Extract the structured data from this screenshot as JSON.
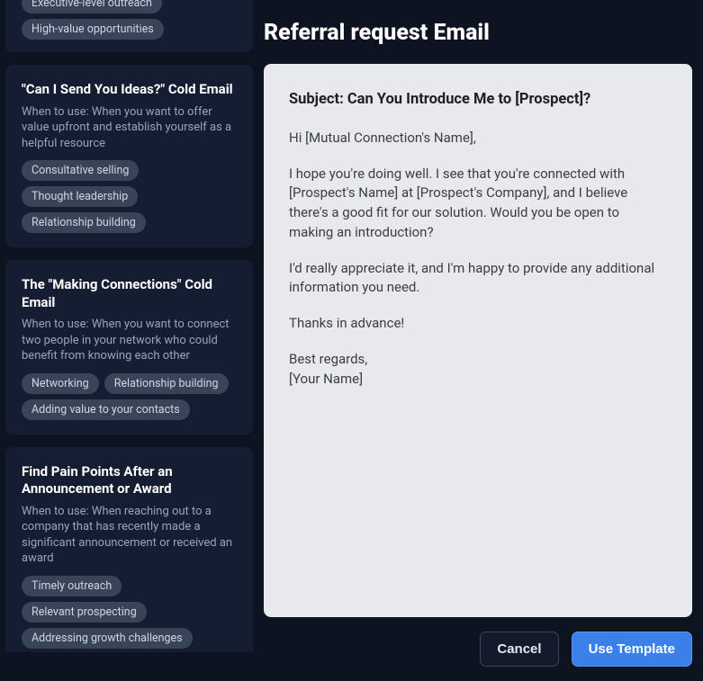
{
  "sidebar": {
    "cards": [
      {
        "title": "",
        "description": "",
        "tags": [
          "Executive-level outreach",
          "High-value opportunities"
        ]
      },
      {
        "title": "\"Can I Send You Ideas?\" Cold Email",
        "description": "When to use: When you want to offer value upfront and establish yourself as a helpful resource",
        "tags": [
          "Consultative selling",
          "Thought leadership",
          "Relationship building"
        ]
      },
      {
        "title": "The \"Making Connections\" Cold Email",
        "description": "When to use: When you want to connect two people in your network who could benefit from knowing each other",
        "tags": [
          "Networking",
          "Relationship building",
          "Adding value to your contacts"
        ]
      },
      {
        "title": "Find Pain Points After an Announcement or Award",
        "description": "When to use: When reaching out to a company that has recently made a significant announcement or received an award",
        "tags": [
          "Timely outreach",
          "Relevant prospecting",
          "Addressing growth challenges"
        ]
      }
    ]
  },
  "main": {
    "title": "Referral request Email",
    "preview": {
      "subject": "Subject: Can You Introduce Me to [Prospect]?",
      "p1": "Hi [Mutual Connection's Name],",
      "p2": "I hope you're doing well. I see that you're connected with [Prospect's Name] at [Prospect's Company], and I believe there's a good fit for our solution. Would you be open to making an introduction?",
      "p3": "I'd really appreciate it, and I'm happy to provide any additional information you need.",
      "p4": "Thanks in advance!",
      "p5": "Best regards,\n[Your Name]"
    },
    "actions": {
      "cancel": "Cancel",
      "use": "Use Template"
    }
  }
}
